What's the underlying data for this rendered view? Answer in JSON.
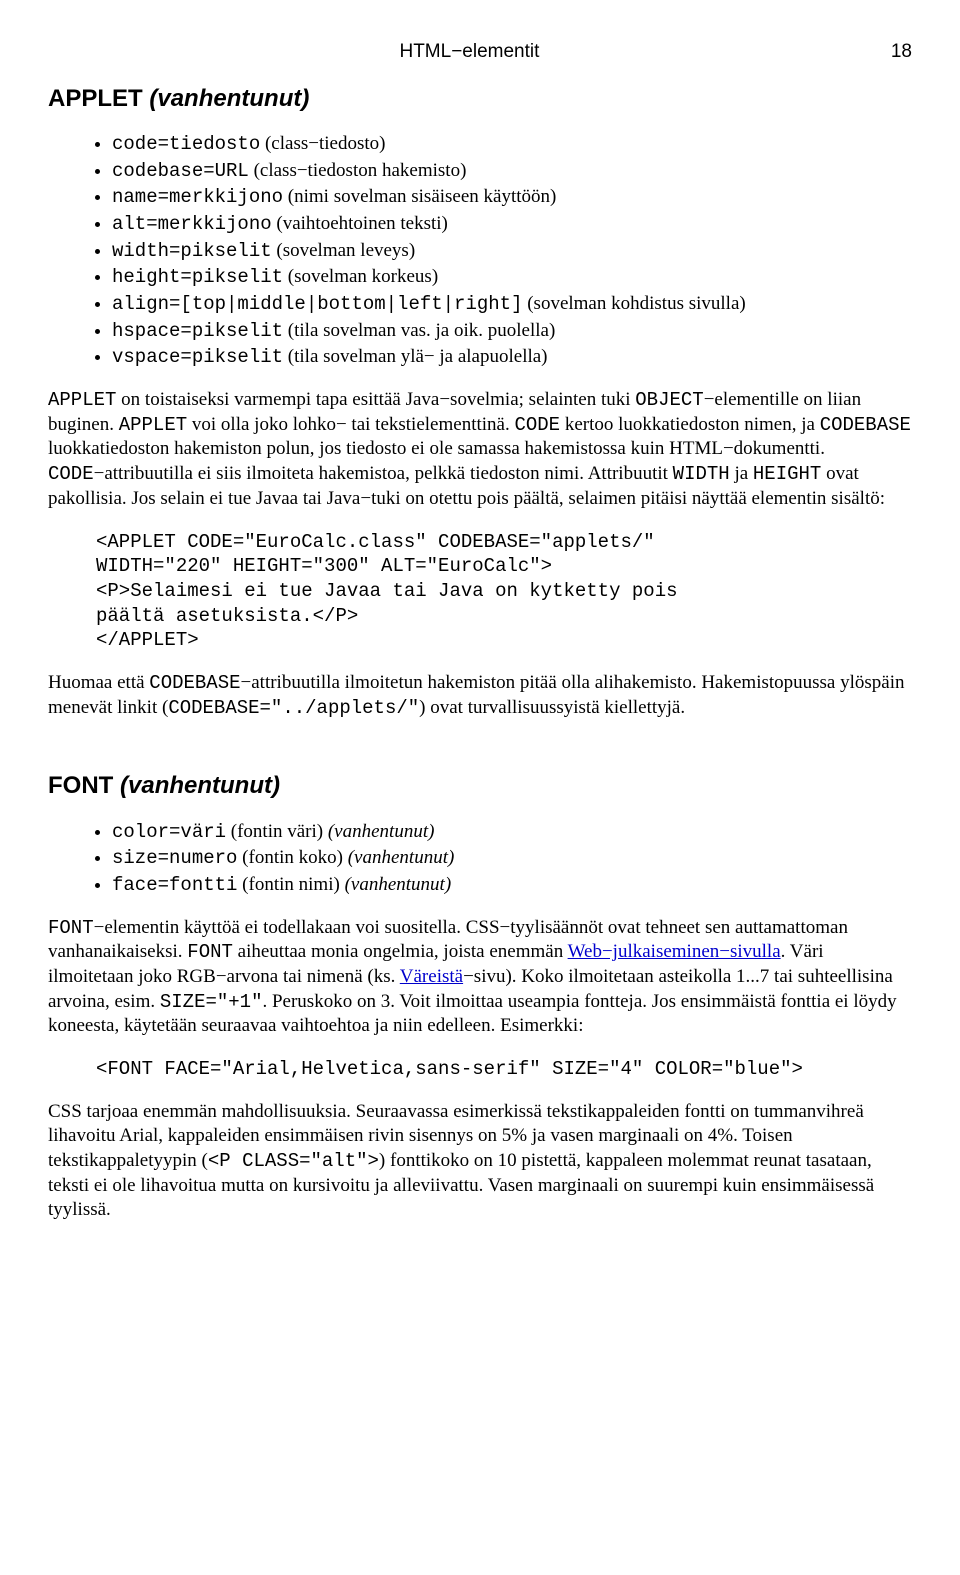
{
  "header": {
    "title": "HTML−elementit",
    "page": "18"
  },
  "applet": {
    "heading_name": "APPLET",
    "heading_deprecated": "(vanhentunut)",
    "items": {
      "i0_code": "code=tiedosto",
      "i0_desc": " (class−tiedosto)",
      "i1_code": "codebase=URL",
      "i1_desc": " (class−tiedoston hakemisto)",
      "i2_code": "name=merkkijono",
      "i2_desc": " (nimi sovelman sisäiseen käyttöön)",
      "i3_code": "alt=merkkijono",
      "i3_desc": " (vaihtoehtoinen teksti)",
      "i4_code": "width=pikselit",
      "i4_desc": " (sovelman leveys)",
      "i5_code": "height=pikselit",
      "i5_desc": " (sovelman korkeus)",
      "i6_code": "align=[top|middle|bottom|left|right]",
      "i6_desc": " (sovelman kohdistus sivulla)",
      "i7_code": "hspace=pikselit",
      "i7_desc": " (tila sovelman vas. ja oik. puolella)",
      "i8_code": "vspace=pikselit",
      "i8_desc": " (tila sovelman ylä− ja alapuolella)"
    },
    "p1": {
      "t0": "APPLET",
      "t1": " on toistaiseksi varmempi tapa esittää Java−sovelmia; selainten tuki ",
      "t2": "OBJECT",
      "t3": "−elementille on liian buginen. ",
      "t4": "APPLET",
      "t5": " voi olla joko lohko− tai tekstielementtinä. ",
      "t6": "CODE",
      "t7": " kertoo luokkatiedoston nimen, ja ",
      "t8": "CODEBASE",
      "t9": " luokkatiedoston hakemiston polun, jos tiedosto ei ole samassa hakemistossa kuin HTML−dokumentti. ",
      "t10": "CODE",
      "t11": "−attribuutilla ei siis ilmoiteta hakemistoa, pelkkä tiedoston nimi. Attribuutit ",
      "t12": "WIDTH",
      "t13": " ja ",
      "t14": "HEIGHT",
      "t15": " ovat pakollisia. Jos selain ei tue Javaa tai Java−tuki on otettu pois päältä, selaimen pitäisi näyttää elementin sisältö:"
    },
    "code1": "<APPLET CODE=\"EuroCalc.class\" CODEBASE=\"applets/\"\nWIDTH=\"220\" HEIGHT=\"300\" ALT=\"EuroCalc\">\n<P>Selaimesi ei tue Javaa tai Java on kytketty pois\npäältä asetuksista.</P>\n</APPLET>",
    "p2": {
      "t0": "Huomaa että ",
      "t1": "CODEBASE",
      "t2": "−attribuutilla ilmoitetun hakemiston pitää olla alihakemisto. Hakemistopuussa ylöspäin menevät linkit (",
      "t3": "CODEBASE=\"../applets/\"",
      "t4": ") ovat turvallisuussyistä kiellettyjä."
    }
  },
  "font": {
    "heading_name": "FONT",
    "heading_deprecated": "(vanhentunut)",
    "items": {
      "i0_code": "color=väri",
      "i0_desc": " (fontin väri) ",
      "i0_dep": "(vanhentunut)",
      "i1_code": "size=numero",
      "i1_desc": " (fontin koko) ",
      "i1_dep": "(vanhentunut)",
      "i2_code": "face=fontti",
      "i2_desc": " (fontin nimi) ",
      "i2_dep": "(vanhentunut)"
    },
    "p1": {
      "t0": "FONT",
      "t1": "−elementin käyttöä ei todellakaan voi suositella. CSS−tyylisäännöt ovat tehneet sen auttamattoman vanhanaikaiseksi. ",
      "t2": "FONT",
      "t3": " aiheuttaa monia ongelmia, joista enemmän ",
      "link1": "Web−julkaiseminen−sivulla",
      "t4": ". Väri ilmoitetaan joko RGB−arvona tai nimenä (ks. ",
      "link2": "Väreistä",
      "t5": "−sivu). Koko ilmoitetaan asteikolla 1...7 tai suhteellisina arvoina, esim. ",
      "t6": "SIZE=\"+1\"",
      "t7": ". Peruskoko on 3. Voit ilmoittaa useampia fontteja. Jos ensimmäistä fonttia ei löydy koneesta, käytetään seuraavaa vaihtoehtoa ja niin edelleen. Esimerkki:"
    },
    "code1": "<FONT FACE=\"Arial,Helvetica,sans-serif\" SIZE=\"4\" COLOR=\"blue\">",
    "p2": {
      "t0": "CSS tarjoaa enemmän mahdollisuuksia. Seuraavassa esimerkissä tekstikappaleiden fontti on tummanvihreä lihavoitu Arial, kappaleiden ensimmäisen rivin sisennys on 5% ja vasen marginaali on 4%. Toisen tekstikappaletyypin (",
      "t1": "<P CLASS=\"alt\">",
      "t2": ") fonttikoko on 10 pistettä, kappaleen molemmat reunat tasataan, teksti ei ole lihavoitua mutta on kursivoitu ja alleviivattu. Vasen marginaali on suurempi kuin ensimmäisessä tyylissä."
    }
  }
}
